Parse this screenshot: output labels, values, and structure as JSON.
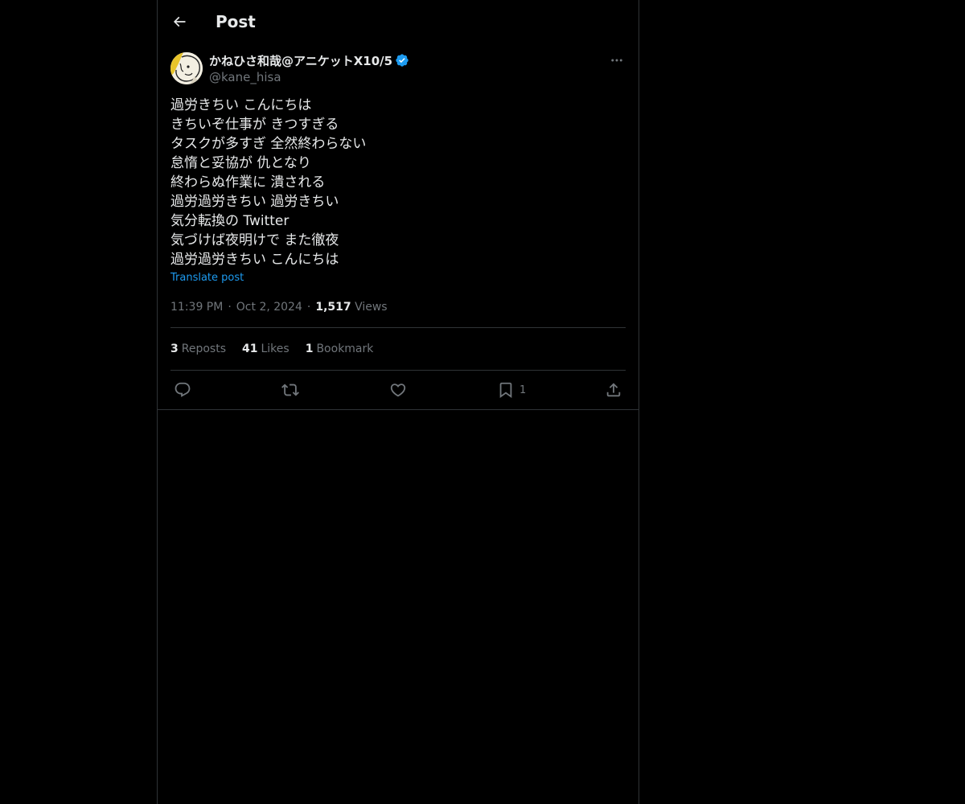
{
  "header": {
    "title": "Post",
    "back_icon": "arrow-left-icon"
  },
  "post": {
    "author": {
      "display_name": "かねひさ和哉@アニケットX10/5",
      "handle": "@kane_hisa",
      "verified": true,
      "verified_color": "#1d9bf0"
    },
    "lines": [
      "過労きちい こんにちは",
      "きちいぞ仕事が きつすぎる",
      "タスクが多すぎ 全然終わらない",
      "怠惰と妥協が 仇となり",
      "終わらぬ作業に 潰される",
      "過労過労きちい 過労きちい",
      "気分転換の Twitter",
      "気づけば夜明けで また徹夜",
      "過労過労きちい こんにちは"
    ],
    "translate_label": "Translate post",
    "time": "11:39 PM",
    "date": "Oct 2, 2024",
    "separator": "·",
    "views_count": "1,517",
    "views_label": "Views",
    "stats": {
      "reposts_count": "3",
      "reposts_label": "Reposts",
      "likes_count": "41",
      "likes_label": "Likes",
      "bookmarks_count": "1",
      "bookmarks_label": "Bookmark"
    },
    "actions": {
      "reply_icon": "reply-icon",
      "repost_icon": "repost-icon",
      "like_icon": "heart-icon",
      "bookmark_icon": "bookmark-icon",
      "bookmark_count": "1",
      "share_icon": "share-icon"
    }
  },
  "colors": {
    "background": "#000000",
    "text": "#e7e9ea",
    "muted": "#71767b",
    "border": "#2f3336",
    "accent": "#1d9bf0"
  }
}
